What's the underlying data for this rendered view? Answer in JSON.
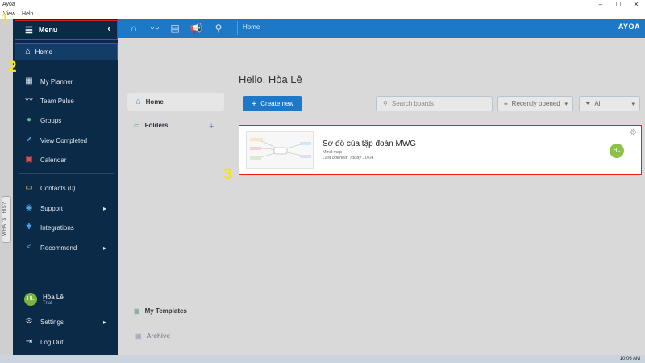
{
  "window": {
    "title": "Ayoa",
    "minimize": "–",
    "maximize": "☐",
    "close": "✕"
  },
  "menubar": {
    "items": [
      "View",
      "Help"
    ]
  },
  "topbar": {
    "breadcrumb": "Home",
    "logo": "AYOA"
  },
  "sidebar": {
    "menu_label": "Menu",
    "home_label": "Home",
    "items": [
      {
        "label": "My Planner",
        "icon": "planner-icon"
      },
      {
        "label": "Team Pulse",
        "icon": "pulse-icon"
      },
      {
        "label": "Groups",
        "icon": "groups-icon"
      },
      {
        "label": "View Completed",
        "icon": "check-icon"
      },
      {
        "label": "Calendar",
        "icon": "calendar-icon"
      },
      {
        "label": "Contacts (0)",
        "icon": "contacts-icon"
      },
      {
        "label": "Support",
        "icon": "support-icon"
      },
      {
        "label": "Integrations",
        "icon": "integrations-icon"
      },
      {
        "label": "Recommend",
        "icon": "share-icon"
      }
    ],
    "user": {
      "initials": "HL",
      "name": "Hòa Lê",
      "plan": "Trial"
    },
    "settings_label": "Settings",
    "logout_label": "Log Out"
  },
  "whats_this": "WHAT'S THIS?",
  "annotations": [
    "1",
    "2",
    "3"
  ],
  "main": {
    "nav": {
      "home": "Home",
      "folders": "Folders",
      "templates": "My Templates",
      "archive": "Archive"
    },
    "greeting": "Hello, Hòa Lê",
    "create_new": "Create new",
    "search": {
      "placeholder": "Search boards"
    },
    "sort_selected": "Recently opened",
    "filter_selected": "All",
    "board": {
      "title": "Sơ đồ của tập đoàn MWG",
      "type": "Mind map",
      "last_opened": "Last opened: Today 10:04",
      "owner_initials": "HL"
    }
  },
  "taskbar": {
    "clock": "10:06 AM"
  },
  "colors": {
    "accent": "#1e78c8",
    "sidebar": "#0b2a47",
    "highlight": "#e02020",
    "annotation": "#f5e31b"
  }
}
